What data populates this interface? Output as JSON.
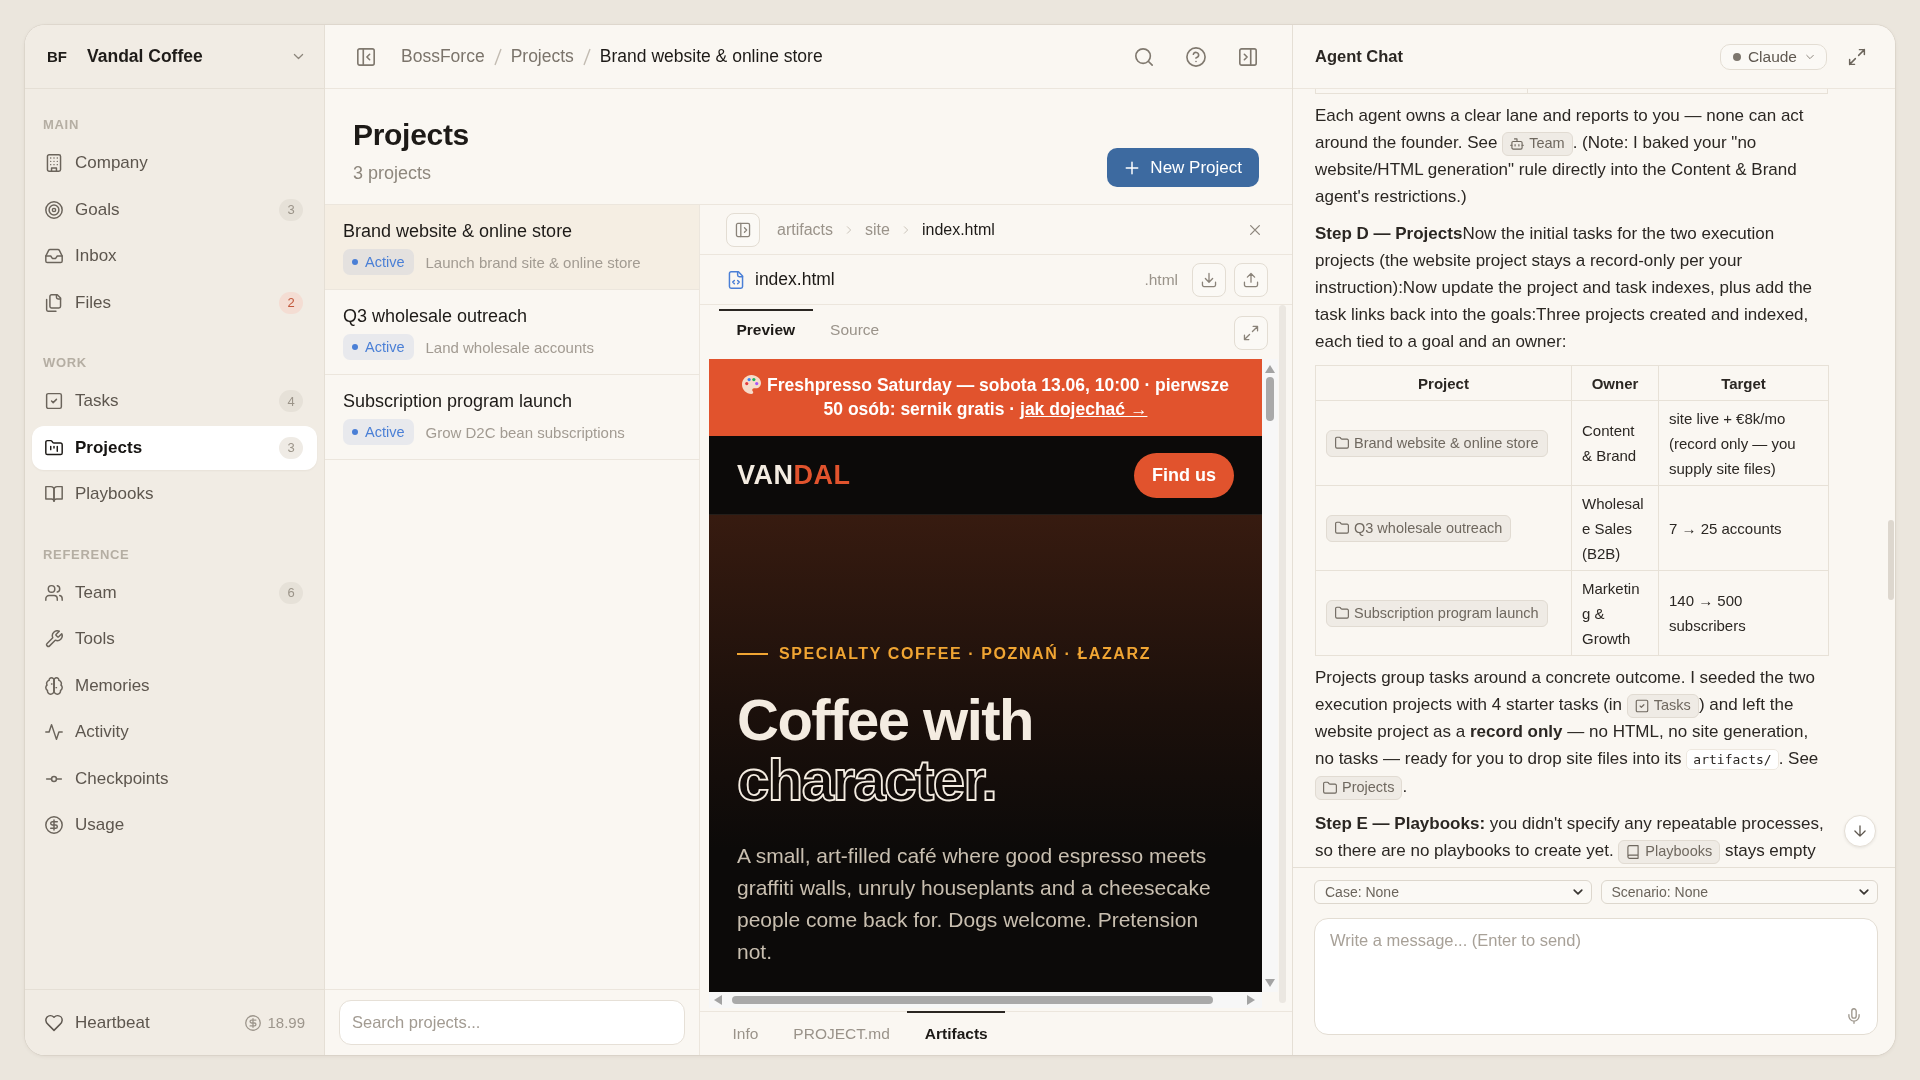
{
  "sidebar": {
    "workspace": {
      "initials": "BF",
      "name": "Vandal Coffee"
    },
    "sections": [
      {
        "label": "MAIN",
        "items": [
          {
            "label": "Company",
            "selected": false
          },
          {
            "label": "Goals",
            "badge": {
              "text": "3",
              "alert": false
            },
            "selected": false
          },
          {
            "label": "Inbox",
            "selected": false
          },
          {
            "label": "Files",
            "badge": {
              "text": "2",
              "alert": true
            },
            "selected": false
          }
        ]
      },
      {
        "label": "WORK",
        "items": [
          {
            "label": "Tasks",
            "badge": {
              "text": "4",
              "alert": false
            },
            "selected": false
          },
          {
            "label": "Projects",
            "badge": {
              "text": "3",
              "alert": false
            },
            "selected": true
          },
          {
            "label": "Playbooks",
            "selected": false
          }
        ]
      },
      {
        "label": "REFERENCE",
        "items": [
          {
            "label": "Team",
            "badge": {
              "text": "6",
              "alert": false
            },
            "selected": false
          },
          {
            "label": "Tools",
            "selected": false
          },
          {
            "label": "Memories",
            "selected": false
          },
          {
            "label": "Activity",
            "selected": false
          },
          {
            "label": "Checkpoints",
            "selected": false
          },
          {
            "label": "Usage",
            "selected": false
          }
        ]
      }
    ],
    "footer": {
      "label": "Heartbeat",
      "cost": "18.99"
    }
  },
  "topbar": {
    "breadcrumb": [
      {
        "label": "BossForce",
        "current": false
      },
      {
        "label": "Projects",
        "current": false
      },
      {
        "label": "Brand website & online store",
        "current": true
      }
    ]
  },
  "projects_page": {
    "title": "Projects",
    "subtitle": "3 projects",
    "new_button": "New Project",
    "projects": [
      {
        "title": "Brand website & online store",
        "status": "Active",
        "description": "Launch brand site & online store",
        "selected": true
      },
      {
        "title": "Q3 wholesale outreach",
        "status": "Active",
        "description": "Land wholesale accounts",
        "selected": false
      },
      {
        "title": "Subscription program launch",
        "status": "Active",
        "description": "Grow D2C bean subscriptions",
        "selected": false
      }
    ],
    "search": {
      "placeholder": "Search projects..."
    }
  },
  "artifact_viewer": {
    "path": [
      {
        "label": "artifacts",
        "current": false
      },
      {
        "label": "site",
        "current": false
      },
      {
        "label": "index.html",
        "current": true
      }
    ],
    "file": {
      "name": "index.html",
      "extension": ".html"
    },
    "view_tabs": [
      {
        "label": "Preview",
        "selected": true
      },
      {
        "label": "Source",
        "selected": false
      }
    ],
    "preview": {
      "banner": {
        "text": "Freshpresso Saturday — sobota 13.06, 10:00 · pierwsze 50 osób: sernik gratis ·",
        "link": "jak dojechać →"
      },
      "logo": {
        "lead": "VAN",
        "accent": "DAL"
      },
      "nav_button": "Find us",
      "eyebrow": "SPECIALTY COFFEE · POZNAŃ · ŁAZARZ",
      "headline": "Coffee with",
      "headline_outlined": "character.",
      "intro": "A small, art-filled café where good espresso meets graffiti walls, unruly houseplants and a cheesecake people come back for. Dogs welcome. Pretension not."
    },
    "bottom_tabs": [
      {
        "label": "Info",
        "selected": false
      },
      {
        "label": "PROJECT.md",
        "selected": false
      },
      {
        "label": "Artifacts",
        "selected": true
      }
    ]
  },
  "chat": {
    "title": "Agent Chat",
    "model_select": {
      "label": "Claude"
    },
    "blocks": [
      {
        "kind": "paragraph",
        "segments": [
          {
            "kind": "text",
            "text": "Each agent owns a clear lane and reports to you — none can act around the founder. See "
          },
          {
            "kind": "team_link",
            "text": "Team"
          },
          {
            "kind": "text",
            "text": ". (Note: I baked your \"no website/HTML generation\" rule directly into the Content & Brand agent's restrictions.)"
          }
        ]
      },
      {
        "kind": "paragraph",
        "segments": [
          {
            "kind": "text",
            "text": "**Step D — Projects**Now the initial tasks for the two execution projects (the website project stays a record‑only per your instruction):Now update the project and task indexes, plus add the task links back into the goals:Three projects created and indexed, each tied to a goal and an owner:"
          }
        ]
      },
      {
        "kind": "table",
        "columns": [
          "Project",
          "Owner",
          "Target"
        ],
        "rows": [
          {
            "project": "Brand website & online store",
            "owner": "Content & Brand",
            "target": "site live + €8k/mo (record only — you supply site files)"
          },
          {
            "project": "Q3 wholesale outreach",
            "owner": "Wholesale Sales (B2B)",
            "target": "7 → 25 accounts"
          },
          {
            "project": "Subscription program launch",
            "owner": "Marketing & Growth",
            "target": "140 → 500 subscribers"
          }
        ]
      },
      {
        "kind": "paragraph",
        "segments": [
          {
            "kind": "text",
            "text": "Projects group tasks around a concrete outcome. I seeded the two execution projects with 4 starter tasks (in "
          },
          {
            "kind": "tasks_link",
            "text": "Tasks"
          },
          {
            "kind": "text",
            "text": ") and left the website project as a **record only** — no HTML, no site generation, no tasks — ready for you to drop site files into its "
          },
          {
            "kind": "code",
            "text": "artifacts/"
          },
          {
            "kind": "text",
            "text": ". See "
          },
          {
            "kind": "project_link",
            "text": "Projects"
          },
          {
            "kind": "text",
            "text": "."
          }
        ]
      },
      {
        "kind": "paragraph",
        "segments": [
          {
            "kind": "text",
            "text": "**Step E — Playbooks:** you didn't specify any repeatable processes, so there are no playbooks to create yet. "
          },
          {
            "kind": "playbook_link",
            "text": "Playbooks"
          },
          {
            "kind": "text",
            "text": " stays empty"
          }
        ]
      }
    ],
    "context_selects": [
      {
        "label": "Case: None"
      },
      {
        "label": "Scenario: None"
      }
    ],
    "composer": {
      "placeholder": "Write a message... (Enter to send)"
    }
  }
}
